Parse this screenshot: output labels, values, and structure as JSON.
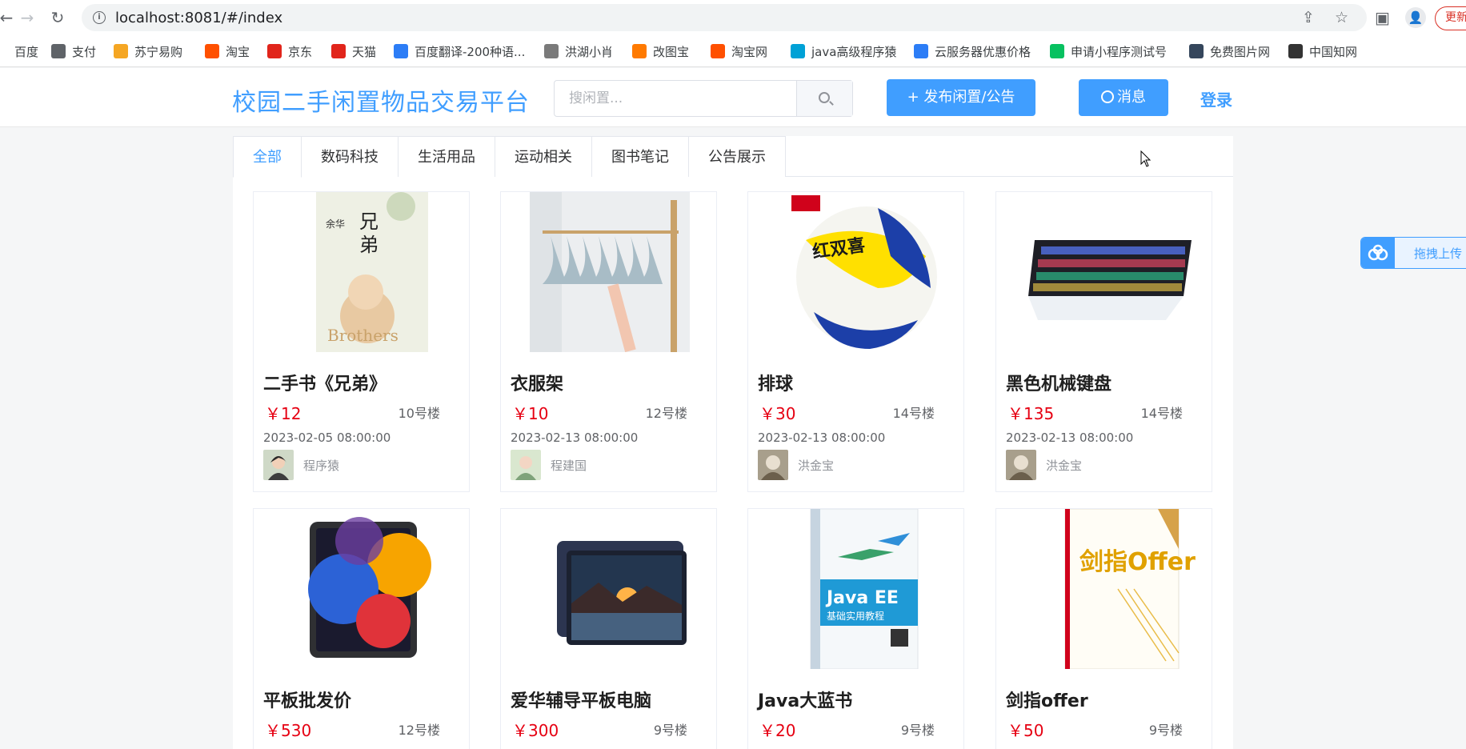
{
  "browser": {
    "url": "localhost:8081/#/index",
    "update_label": "更新",
    "bookmarks": [
      {
        "label": "百度",
        "icon": "baidu-icon",
        "color": "#ffffff"
      },
      {
        "label": "支付",
        "icon": "globe-icon",
        "color": "#5f6368"
      },
      {
        "label": "苏宁易购",
        "icon": "suning-icon",
        "color": "#f5a623"
      },
      {
        "label": "淘宝",
        "icon": "taobao-icon",
        "color": "#ff5000"
      },
      {
        "label": "京东",
        "icon": "jd-icon",
        "color": "#e1251b"
      },
      {
        "label": "天猫",
        "icon": "tmall-icon",
        "color": "#e1251b"
      },
      {
        "label": "百度翻译-200种语...",
        "icon": "translate-icon",
        "color": "#2c7df6"
      },
      {
        "label": "洪湖小肖",
        "icon": "leaf-icon",
        "color": "#7a7a7a"
      },
      {
        "label": "改图宝",
        "icon": "gaitubao-icon",
        "color": "#ff7a00"
      },
      {
        "label": "淘宝网",
        "icon": "taobao-icon",
        "color": "#ff5000"
      },
      {
        "label": "java高级程序猿",
        "icon": "bilibili-icon",
        "color": "#00a1d6"
      },
      {
        "label": "云服务器优惠价格",
        "icon": "cloud-icon",
        "color": "#2c7df6"
      },
      {
        "label": "申请小程序测试号",
        "icon": "wechat-icon",
        "color": "#07c160"
      },
      {
        "label": "免费图片网",
        "icon": "tumblr-icon",
        "color": "#35465c"
      },
      {
        "label": "中国知网",
        "icon": "cnki-icon",
        "color": "#333333"
      }
    ]
  },
  "header": {
    "brand": "校园二手闲置物品交易平台",
    "search_placeholder": "搜闲置...",
    "publish_label": "+ 发布闲置/公告",
    "message_label": "消息",
    "login_label": "登录"
  },
  "tabs": [
    {
      "label": "全部",
      "active": true
    },
    {
      "label": "数码科技",
      "active": false
    },
    {
      "label": "生活用品",
      "active": false
    },
    {
      "label": "运动相关",
      "active": false
    },
    {
      "label": "图书笔记",
      "active": false
    },
    {
      "label": "公告展示",
      "active": false
    }
  ],
  "items": [
    {
      "title": "二手书《兄弟》",
      "price": "￥12",
      "location": "10号楼",
      "date": "2023-02-05 08:00:00",
      "seller": "程序猿"
    },
    {
      "title": "衣服架",
      "price": "￥10",
      "location": "12号楼",
      "date": "2023-02-13 08:00:00",
      "seller": "程建国"
    },
    {
      "title": "排球",
      "price": "￥30",
      "location": "14号楼",
      "date": "2023-02-13 08:00:00",
      "seller": "洪金宝"
    },
    {
      "title": "黑色机械键盘",
      "price": "￥135",
      "location": "14号楼",
      "date": "2023-02-13 08:00:00",
      "seller": "洪金宝"
    },
    {
      "title": "平板批发价",
      "price": "￥530",
      "location": "12号楼",
      "date": "",
      "seller": ""
    },
    {
      "title": "爱华辅导平板电脑",
      "price": "￥300",
      "location": "9号楼",
      "date": "",
      "seller": ""
    },
    {
      "title": "Java大蓝书",
      "price": "￥20",
      "location": "9号楼",
      "date": "",
      "seller": ""
    },
    {
      "title": "剑指offer",
      "price": "￥50",
      "location": "9号楼",
      "date": "",
      "seller": ""
    }
  ],
  "images": {
    "book_author": "余华",
    "book_title": "兄弟",
    "book_en": "Brothers",
    "ball_brand": "红双喜",
    "java_cover": "Java EE",
    "java_sub": "基础实用教程",
    "offer_cover": "剑指Offer"
  },
  "upload_widget": {
    "label": "拖拽上传"
  }
}
